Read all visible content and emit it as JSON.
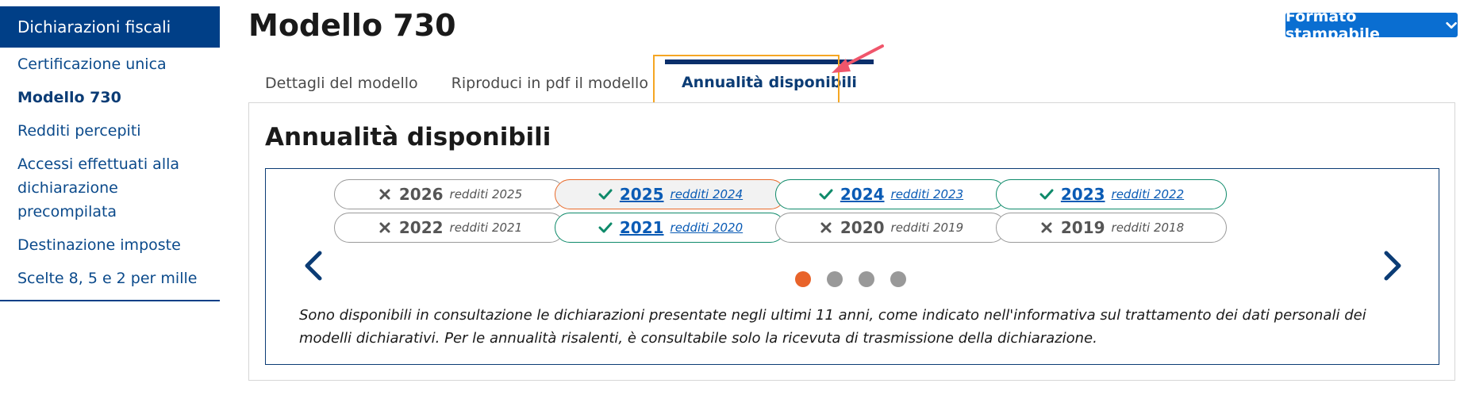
{
  "sidebar": {
    "header": "Dichiarazioni fiscali",
    "items": [
      {
        "label": "Certificazione unica"
      },
      {
        "label": "Modello 730"
      },
      {
        "label": "Redditi percepiti"
      },
      {
        "label": "Accessi effettuati alla dichiarazione precompilata"
      },
      {
        "label": "Destinazione imposte"
      },
      {
        "label": "Scelte 8, 5 e 2 per mille"
      }
    ]
  },
  "header": {
    "title": "Modello 730",
    "print_label": "Formato stampabile"
  },
  "tabs": [
    {
      "label": "Dettagli del modello"
    },
    {
      "label": "Riproduci in pdf il modello"
    },
    {
      "label": "Annualità disponibili"
    }
  ],
  "panel": {
    "title": "Annualità disponibili",
    "years": [
      {
        "year": "2026",
        "sub": "redditi 2025",
        "available": false
      },
      {
        "year": "2025",
        "sub": "redditi 2024",
        "available": true
      },
      {
        "year": "2024",
        "sub": "redditi 2023",
        "available": true
      },
      {
        "year": "2023",
        "sub": "redditi 2022",
        "available": true
      },
      {
        "year": "2022",
        "sub": "redditi 2021",
        "available": false
      },
      {
        "year": "2021",
        "sub": "redditi 2020",
        "available": true
      },
      {
        "year": "2020",
        "sub": "redditi 2019",
        "available": false
      },
      {
        "year": "2019",
        "sub": "redditi 2018",
        "available": false
      }
    ],
    "info": "Sono disponibili in consultazione le dichiarazioni presentate negli ultimi 11 anni, come indicato nell'informativa sul trattamento dei dati personali dei modelli dichiarativi. Per le annualità risalenti, è consultabile solo la ricevuta di trasmissione della dichiarazione."
  },
  "colors": {
    "brand": "#003f87",
    "accent": "#0a6ed1",
    "available": "#0e8a6a",
    "selected": "#e86a2a",
    "highlight": "#f5a623"
  }
}
